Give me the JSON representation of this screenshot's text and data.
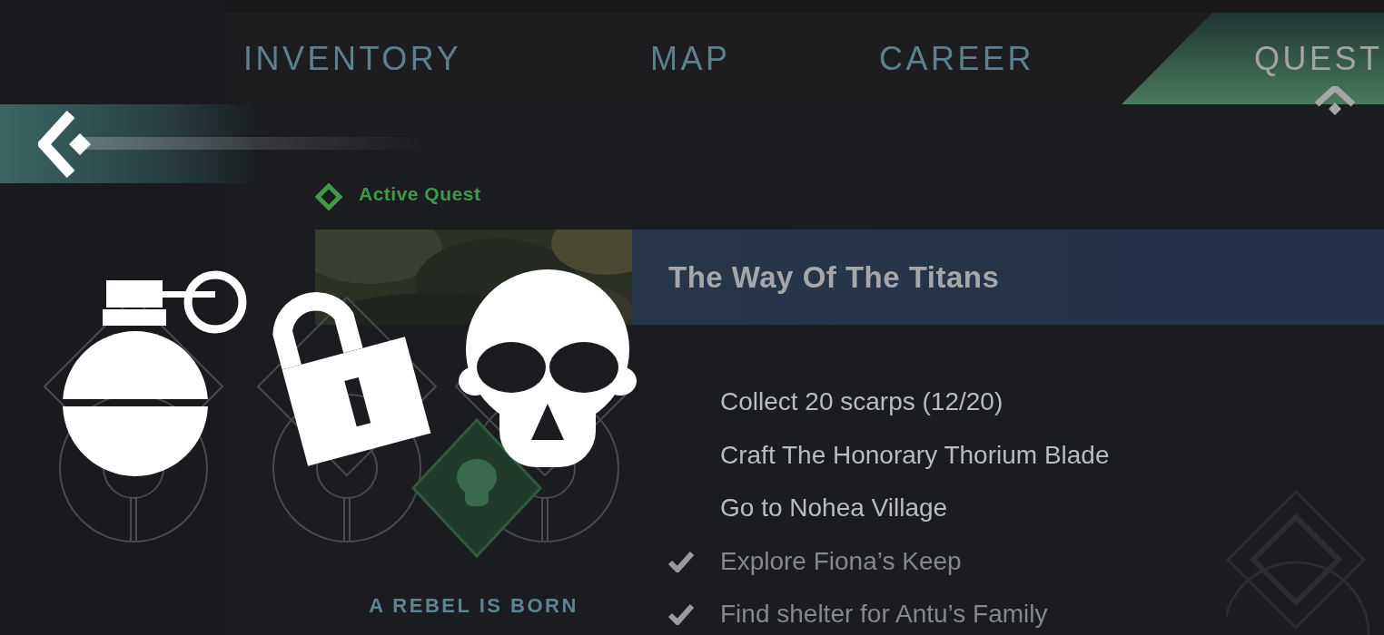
{
  "tabs": [
    {
      "label": "INVENTORY",
      "selected": false
    },
    {
      "label": "MAP",
      "selected": false
    },
    {
      "label": "CAREER",
      "selected": false
    },
    {
      "label": "QUEST",
      "selected": true
    }
  ],
  "section_label": "Active Quest",
  "quest": {
    "title": "The Way Of The Titans",
    "objectives": [
      {
        "text": "Collect 20 scarps  (12/20)",
        "completed": false
      },
      {
        "text": "Craft The Honorary Thorium Blade",
        "completed": false
      },
      {
        "text": "Go to Nohea Village",
        "completed": false
      },
      {
        "text": "Explore Fiona’s Keep",
        "completed": true
      },
      {
        "text": "Find shelter for Antu’s Family",
        "completed": true
      }
    ]
  },
  "rewards": [
    {
      "kind": "grenade"
    },
    {
      "kind": "padlock"
    },
    {
      "kind": "skull"
    }
  ],
  "chapter": "A REBEL IS BORN"
}
